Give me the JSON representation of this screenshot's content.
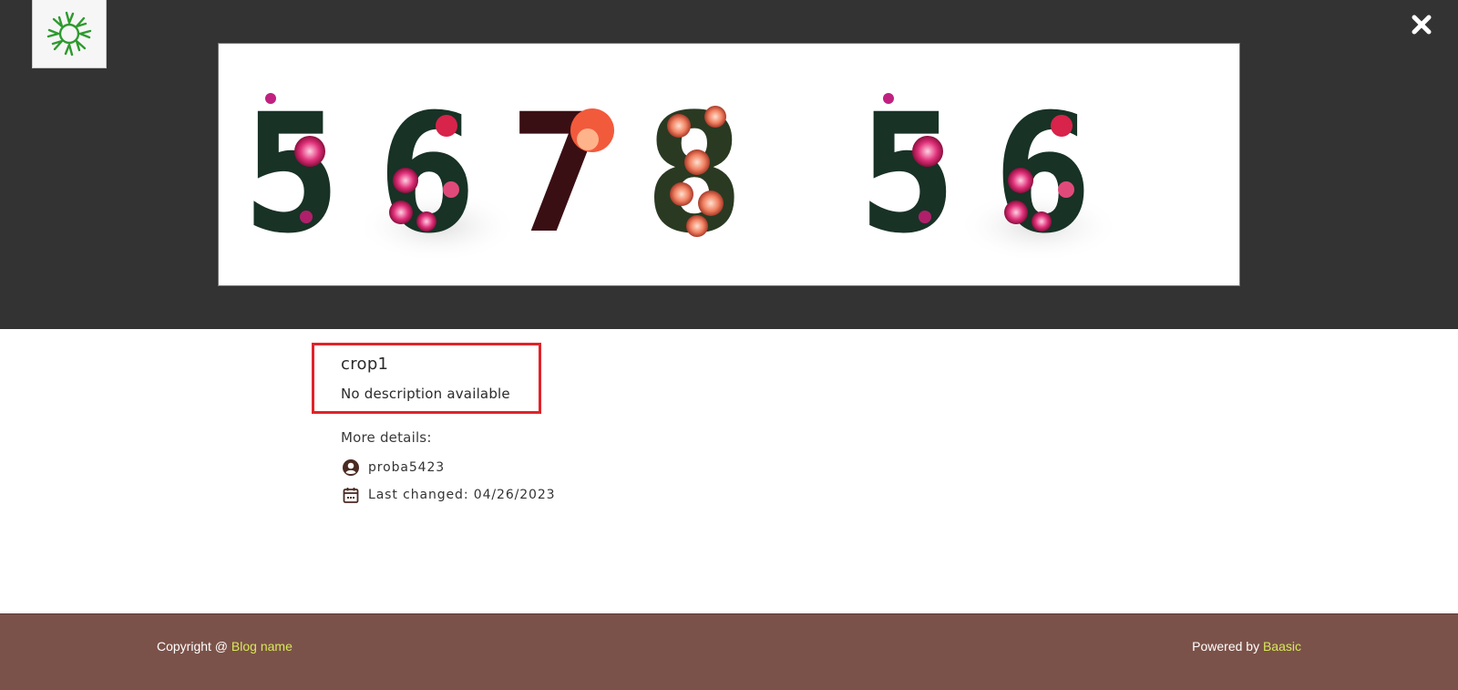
{
  "header": {
    "logo_icon": "sun-logo-icon",
    "close_icon": "close-icon"
  },
  "image": {
    "digits": [
      "5",
      "6",
      "7",
      "8",
      "5",
      "6"
    ]
  },
  "item": {
    "title": "crop1",
    "description": "No description available",
    "more_details_label": "More details:",
    "author": "proba5423",
    "last_changed": "Last changed: 04/26/2023"
  },
  "footer": {
    "copyright_prefix": "Copyright @ ",
    "blog_link": "Blog name",
    "powered_prefix": "Powered by ",
    "powered_link": "Baasic"
  },
  "colors": {
    "top_band": "#333333",
    "highlight_border": "#e0232a",
    "footer_bg": "#7b5249",
    "footer_link": "#d7e85a",
    "logo_green": "#2e9a2e"
  }
}
